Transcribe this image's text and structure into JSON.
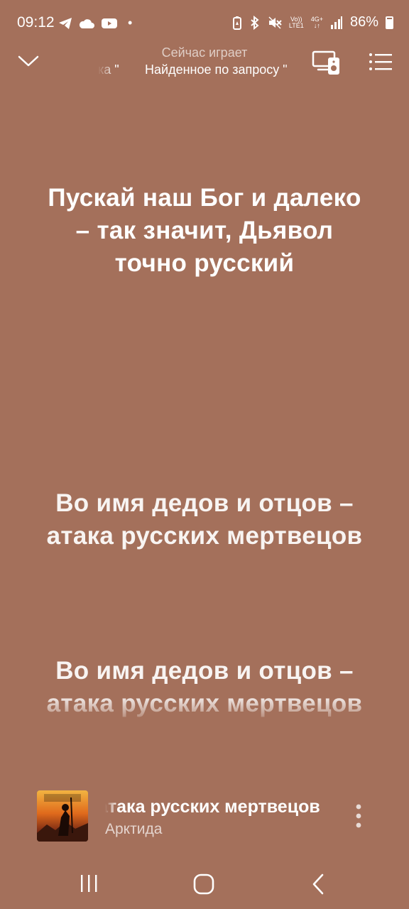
{
  "status_bar": {
    "time": "09:12",
    "dot": "•",
    "network_top": "Vo))",
    "network_bottom": "LTE1",
    "net_type_top": "4G+",
    "net_type_bottom": "↓↑",
    "battery": "86%",
    "left_icons": [
      "telegram-icon",
      "cloud-icon",
      "youtube-icon"
    ],
    "right_icons": [
      "battery-saver-icon",
      "bluetooth-icon",
      "mute-icon",
      "signal-icon",
      "battery-icon"
    ]
  },
  "header": {
    "title": "Сейчас играет",
    "subtitle_left": "ка \"",
    "subtitle_main": "Найденное по запросу \""
  },
  "lyrics": [
    {
      "text": "Пускай наш Бог и далеко – так значит, Дьявол точно русский"
    },
    {
      "text": "Во имя дедов и отцов – атака русских мертвецов"
    },
    {
      "text": "Во имя дедов и отцов – атака русских мертвецов"
    }
  ],
  "mini_player": {
    "title": "атака русских мертвецов",
    "artist": "Арктида",
    "cover_brand": "Арктида"
  },
  "colors": {
    "background": "#a4705b",
    "text": "#ffffff"
  }
}
